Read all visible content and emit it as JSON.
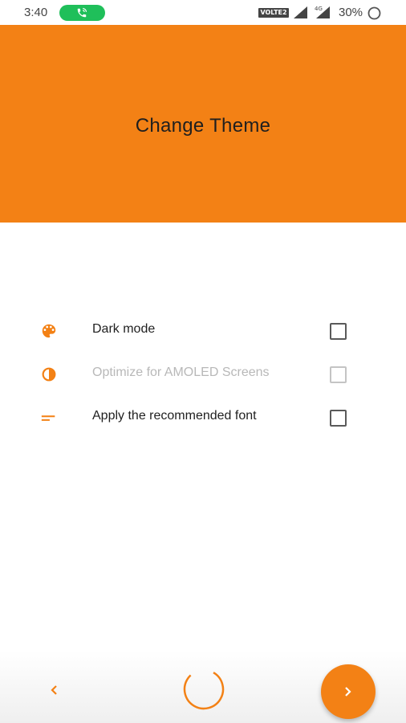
{
  "status_bar": {
    "time": "3:40",
    "network_badge": "VOLTE2",
    "battery": "30%",
    "icons": [
      "phone-call-icon",
      "signal-icon",
      "mobile-data-signal-icon",
      "battery-icon"
    ]
  },
  "header": {
    "title": "Change Theme",
    "background": "#f38115"
  },
  "options": [
    {
      "icon": "palette-icon",
      "label": "Dark mode",
      "enabled": true,
      "checked": false
    },
    {
      "icon": "contrast-icon",
      "label": "Optimize for AMOLED Screens",
      "enabled": false,
      "checked": false
    },
    {
      "icon": "short-text-icon",
      "label": "Apply the recommended font",
      "enabled": true,
      "checked": false
    }
  ],
  "navigation": {
    "back_icon": "chevron-left-icon",
    "progress_icon": "progress-ring-icon",
    "next_icon": "chevron-right-icon"
  },
  "colors": {
    "accent": "#f38115",
    "disabled_text": "#b8b8b8",
    "call_pill": "#1fbf5a"
  }
}
